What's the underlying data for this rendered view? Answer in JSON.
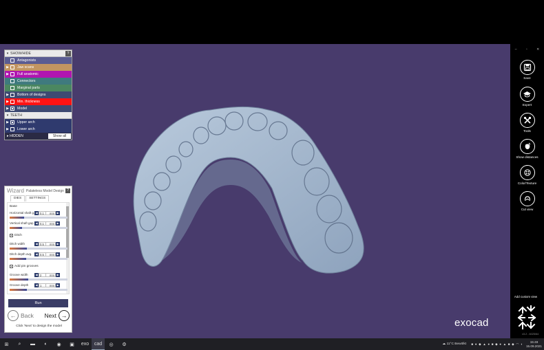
{
  "show_hide": {
    "header": "SHOW/HIDE",
    "help": "?",
    "items": [
      {
        "label": "Antagonists",
        "checked": false,
        "arrow": ""
      },
      {
        "label": "Jaw scans",
        "checked": false,
        "arrow": "▶"
      },
      {
        "label": "Full anatomic",
        "checked": false,
        "arrow": "▶"
      },
      {
        "label": "Connectors",
        "checked": false,
        "arrow": ""
      },
      {
        "label": "Marginal parts",
        "checked": false,
        "arrow": ""
      },
      {
        "label": "Bottom of designs",
        "checked": false,
        "arrow": "▶"
      },
      {
        "label": "Min. thickness",
        "checked": false,
        "arrow": "▶"
      },
      {
        "label": "Model",
        "checked": true,
        "arrow": "▶"
      }
    ],
    "teeth_header": "TEETH",
    "teeth": [
      {
        "label": "Upper arch",
        "checked": true,
        "arrow": "▶"
      },
      {
        "label": "Lower arch",
        "checked": false,
        "arrow": "▶"
      }
    ],
    "hidden_label": "HIDDEN",
    "show_all": "Show all"
  },
  "wizard": {
    "title": "Wizard",
    "subtitle": "Palateless Model Design",
    "help": "?",
    "tabs": [
      "DIES",
      "SETTINGS"
    ],
    "base_label": "Base",
    "params": [
      {
        "name": "Horizontal shaft g...",
        "value": "0.1",
        "unit": "mm",
        "fill": 0.25
      },
      {
        "name": "Vertical shaft gap",
        "value": "0.1",
        "unit": "mm",
        "fill": 0.22
      },
      {
        "name": "Ditch width",
        "value": "0.5",
        "unit": "mm",
        "fill": 0.3
      },
      {
        "name": "Ditch depth avg.",
        "value": "0.5",
        "unit": "mm",
        "fill": 0.28
      },
      {
        "name": "Groove width",
        "value": "2",
        "unit": "mm",
        "fill": 0.32
      },
      {
        "name": "Groove depth",
        "value": "1",
        "unit": "mm",
        "fill": 0.3
      }
    ],
    "ditch_label": "Ditch",
    "pin_label": "Add pin grooves",
    "run": "Run",
    "back": "Back",
    "next": "Next",
    "hint": "Click 'Next' to design the model"
  },
  "brand": "exocad",
  "tools": [
    {
      "label": "Save",
      "icon": "save-icon"
    },
    {
      "label": "Expert",
      "icon": "graduation-cap-icon"
    },
    {
      "label": "Tools",
      "icon": "tools-icon"
    },
    {
      "label": "Show distances",
      "icon": "distances-icon"
    },
    {
      "label": "Color/Texture",
      "icon": "color-texture-icon"
    },
    {
      "label": "Cut view",
      "icon": "cut-view-icon"
    }
  ],
  "window_controls": [
    "–",
    "▫",
    "✕"
  ],
  "add_custom_view": "Add custom view",
  "version": "v3.2 - 6025/64",
  "taskbar": {
    "apps": [
      "⊞",
      "⌕",
      "▬",
      "◐",
      "◉",
      "▣",
      "exo",
      "cad",
      "◎",
      "⚙"
    ],
    "weather": "11°C  Bewölkt",
    "time": "15:49",
    "date": "15.09.2021"
  },
  "colors": {
    "viewport_bg": "#483b6c",
    "model": "#a9bcd1"
  }
}
